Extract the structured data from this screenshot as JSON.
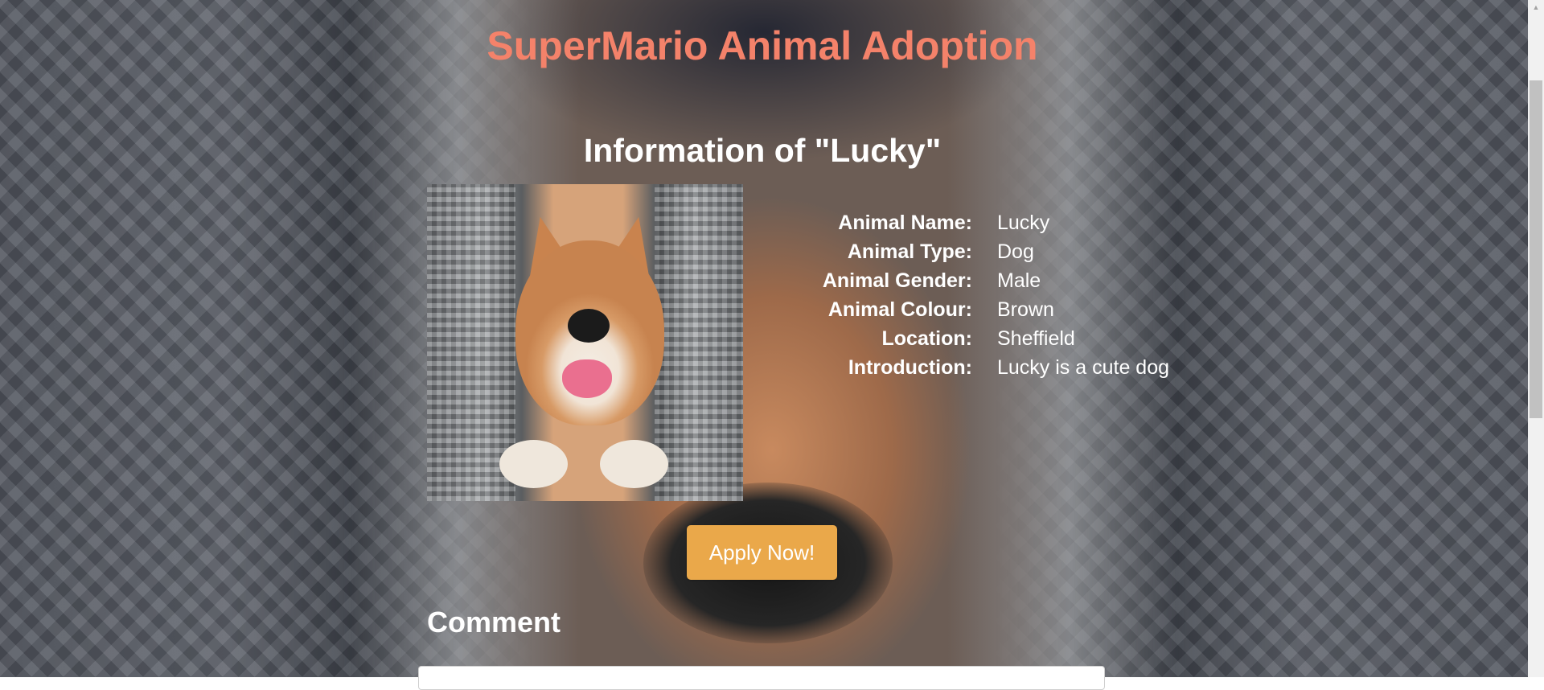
{
  "page": {
    "title": "SuperMario Animal Adoption",
    "subtitle": "Information of \"Lucky\""
  },
  "animal": {
    "photo_description": "Shiba Inu dog smiling in a car seat",
    "fields": [
      {
        "label": "Animal Name:",
        "value": "Lucky"
      },
      {
        "label": "Animal Type:",
        "value": "Dog"
      },
      {
        "label": "Animal Gender:",
        "value": "Male"
      },
      {
        "label": "Animal Colour:",
        "value": "Brown"
      },
      {
        "label": "Location:",
        "value": "Sheffield"
      },
      {
        "label": "Introduction:",
        "value": "Lucky is a cute dog"
      }
    ]
  },
  "actions": {
    "apply_label": "Apply Now!"
  },
  "comment": {
    "heading": "Comment"
  },
  "colors": {
    "title": "#f4826a",
    "button": "#eaa84a",
    "text": "#ffffff"
  }
}
